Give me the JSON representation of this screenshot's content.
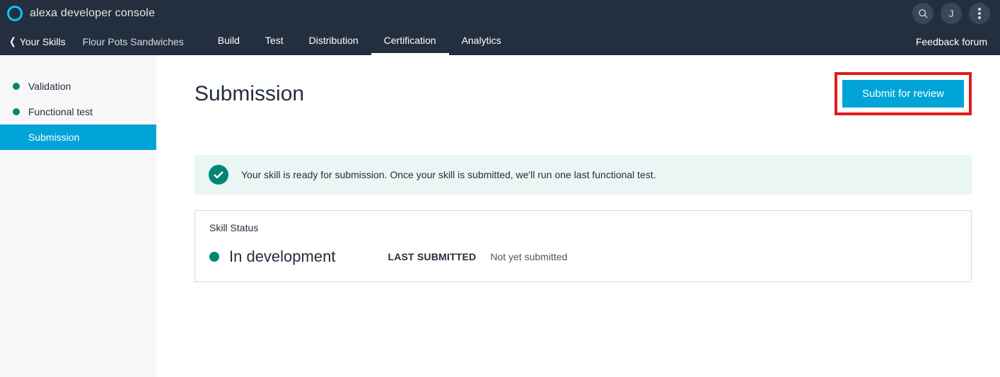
{
  "header": {
    "console_title": "alexa developer console",
    "avatar_initial": "J"
  },
  "subnav": {
    "back_label": "Your Skills",
    "skill_name": "Flour Pots Sandwiches",
    "tabs": [
      {
        "label": "Build"
      },
      {
        "label": "Test"
      },
      {
        "label": "Distribution"
      },
      {
        "label": "Certification",
        "active": true
      },
      {
        "label": "Analytics"
      }
    ],
    "feedback_label": "Feedback forum"
  },
  "sidebar": {
    "items": [
      {
        "label": "Validation",
        "dot": true
      },
      {
        "label": "Functional test",
        "dot": true
      },
      {
        "label": "Submission",
        "dot": false,
        "active": true
      }
    ]
  },
  "main": {
    "title": "Submission",
    "submit_label": "Submit for review",
    "alert_text": "Your skill is ready for submission. Once your skill is submitted, we'll run one last functional test.",
    "status": {
      "title": "Skill Status",
      "value": "In development",
      "last_submitted_label": "LAST SUBMITTED",
      "last_submitted_value": "Not yet submitted"
    }
  }
}
